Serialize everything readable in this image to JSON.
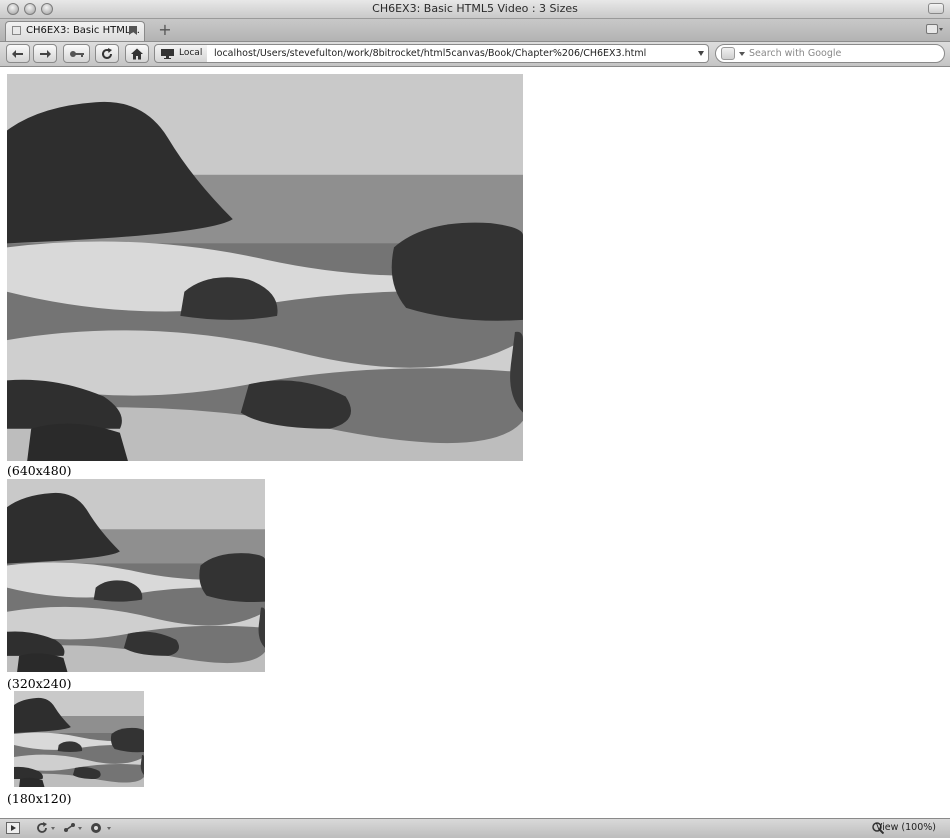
{
  "window": {
    "title": "CH6EX3: Basic HTML5 Video : 3 Sizes"
  },
  "tabs": [
    {
      "label": "CH6EX3: Basic HTML..."
    }
  ],
  "toolbar": {
    "location_label": "Local",
    "url": "localhost/Users/stevefulton/work/8bitrocket/html5canvas/Book/Chapter%206/CH6EX3.html",
    "search_placeholder": "Search with Google"
  },
  "page": {
    "videos": [
      {
        "caption": "(640x480)"
      },
      {
        "caption": "(320x240)"
      },
      {
        "caption": "(180x120)"
      }
    ]
  },
  "statusbar": {
    "zoom_label": "View (100%)"
  },
  "colors": {
    "chrome": "#c9c9c9",
    "sky": "#c7c7c7",
    "sea": "#7a7a7a",
    "rock": "#2e2e2e",
    "foam": "#e2e2e2"
  },
  "icons": [
    "back-icon",
    "forward-icon",
    "key-icon",
    "reload-icon",
    "home-icon",
    "monitor-icon",
    "search-engine-icon",
    "add-tab-icon",
    "play-toggle-icon",
    "sync-icon",
    "share-icon",
    "addon-icon",
    "zoom-icon"
  ]
}
